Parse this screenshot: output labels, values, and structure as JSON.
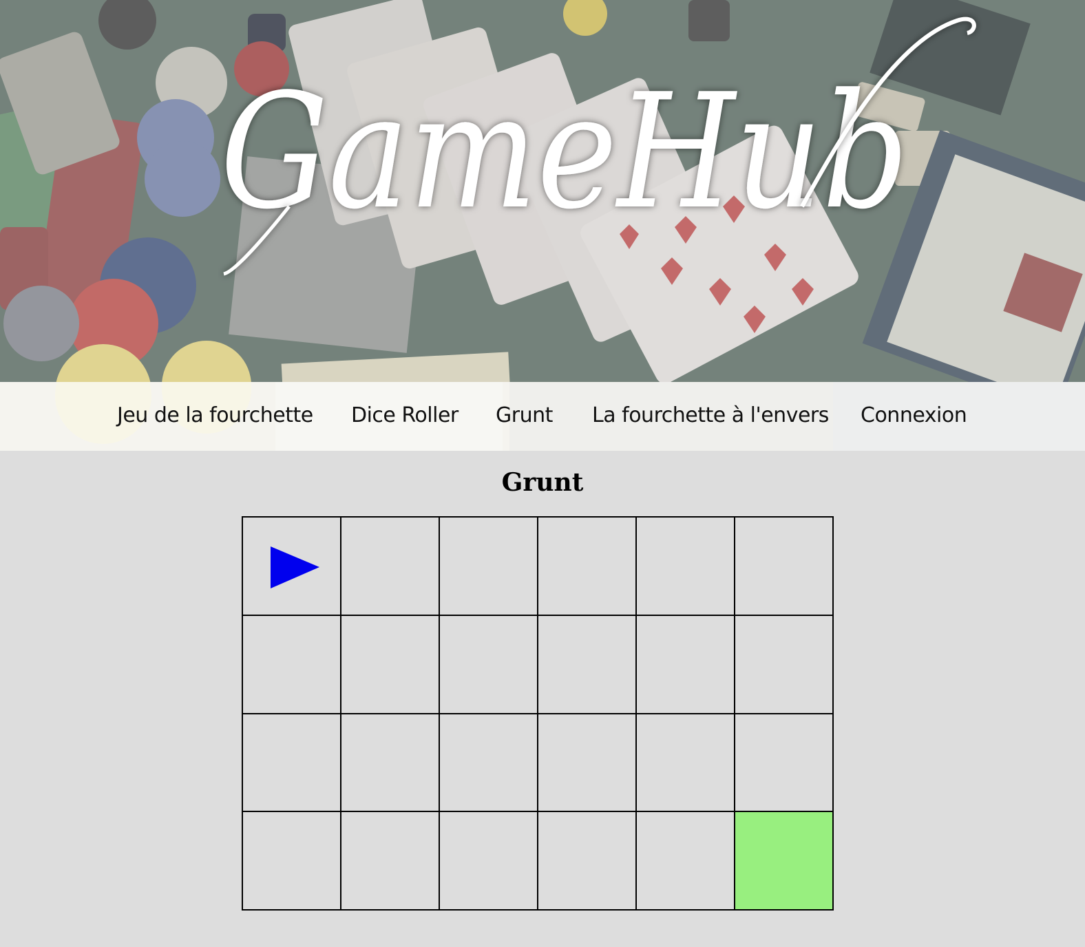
{
  "site": {
    "logo_text": "GameHub"
  },
  "nav": {
    "items": [
      {
        "label": "Jeu de la fourchette"
      },
      {
        "label": "Dice Roller"
      },
      {
        "label": "Grunt"
      },
      {
        "label": "La fourchette à l'envers"
      },
      {
        "label": "Connexion"
      }
    ]
  },
  "game": {
    "title": "Grunt",
    "rows": 4,
    "cols": 6,
    "player": {
      "row": 0,
      "col": 0,
      "direction": "right",
      "icon": "triangle-right-icon",
      "color": "#0000ee"
    },
    "goal": {
      "row": 3,
      "col": 5,
      "color": "#98ef7f"
    }
  }
}
